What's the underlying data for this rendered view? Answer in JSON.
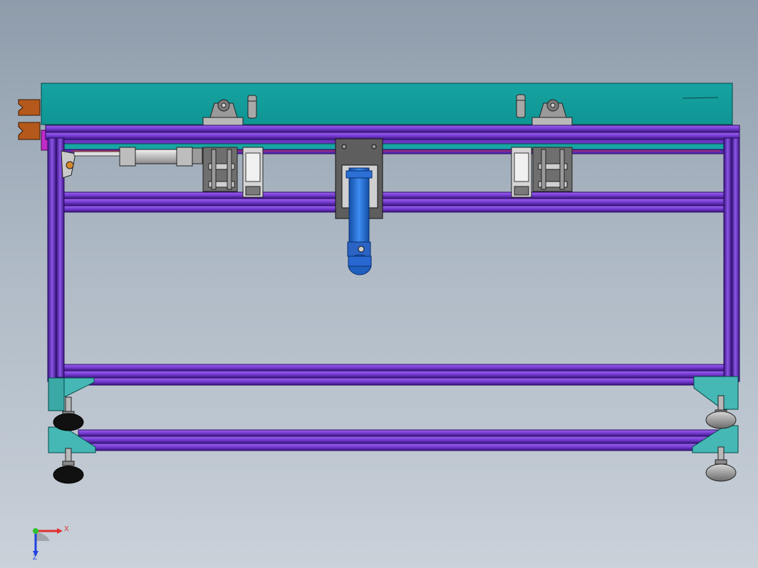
{
  "viewport": {
    "background_top": "#8e9cab",
    "background_bottom": "#c9d1d9"
  },
  "model": {
    "frame_color": "#7a3fd6",
    "frame_dark": "#3a1580",
    "plate_color": "#1aa7a5",
    "bracket_color": "#3fb3b0",
    "cylinder_color": "#1f6fd1",
    "foot_color": "#111111"
  },
  "triad": {
    "x_label": "X",
    "z_label": "Z",
    "x_color": "#e03030",
    "y_color": "#30c030",
    "z_color": "#2040e0"
  }
}
